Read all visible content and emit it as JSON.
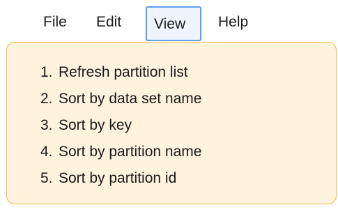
{
  "menubar": {
    "items": [
      "File",
      "Edit",
      "View",
      "Help"
    ]
  },
  "dropdown": {
    "items": [
      {
        "num": "1.",
        "label": "Refresh partition list"
      },
      {
        "num": "2.",
        "label": "Sort by data set name"
      },
      {
        "num": "3.",
        "label": "Sort by key"
      },
      {
        "num": "4.",
        "label": "Sort by partition name"
      },
      {
        "num": "5.",
        "label": "Sort by partition id"
      }
    ]
  },
  "colors": {
    "menu_highlight_border": "#5aa0f5",
    "dropdown_background": "#fff3de",
    "dropdown_border": "#f0b84a"
  }
}
